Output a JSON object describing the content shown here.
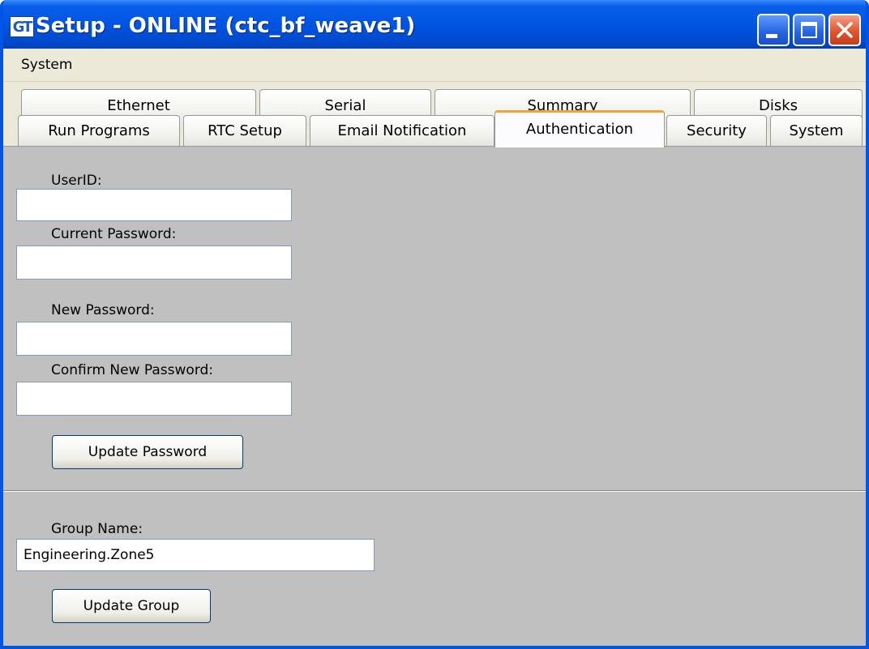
{
  "window": {
    "title": "Setup - ONLINE (ctc_bf_weave1)",
    "app_icon_text": "GT",
    "controls": [
      "minimize-icon",
      "maximize-icon",
      "close-icon"
    ]
  },
  "menu": {
    "items": [
      "System"
    ]
  },
  "tabs": {
    "row1": [
      "Ethernet",
      "Serial",
      "Summary",
      "Disks"
    ],
    "row2": [
      "Run Programs",
      "RTC Setup",
      "Email Notification",
      "Authentication",
      "Security",
      "System"
    ],
    "active": "Authentication"
  },
  "auth": {
    "userid_label": "UserID:",
    "userid_value": "",
    "current_password_label": "Current Password:",
    "current_password_value": "",
    "new_password_label": "New Password:",
    "new_password_value": "",
    "confirm_password_label": "Confirm New Password:",
    "confirm_password_value": "",
    "update_password_label": "Update Password"
  },
  "group": {
    "group_name_label": "Group Name:",
    "group_name_value": "Engineering.Zone5",
    "update_group_label": "Update Group"
  },
  "colors": {
    "titlebar": "#0054e3",
    "panel": "#c0c0c0",
    "active_tab_accent": "#f5a434",
    "close_button": "#e0552f"
  }
}
